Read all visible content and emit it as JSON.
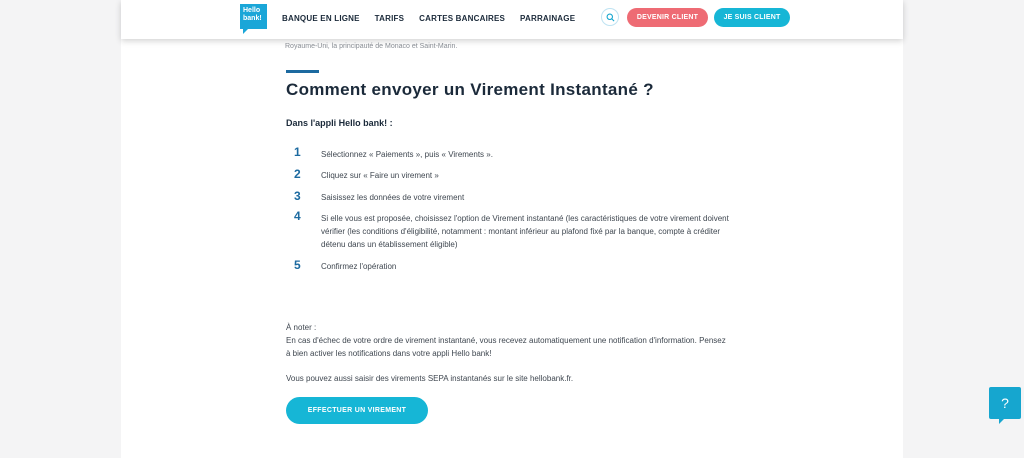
{
  "header": {
    "logo_text": "Hello bank!",
    "nav": [
      "BANQUE EN LIGNE",
      "TARIFS",
      "CARTES BANCAIRES",
      "PARRAINAGE"
    ],
    "search_icon": "search-icon",
    "btn_devenir": "DEVENIR CLIENT",
    "btn_suis": "JE SUIS CLIENT"
  },
  "content": {
    "clipped_text": "Royaume-Uni, la principauté de Monaco et Saint-Marin.",
    "heading": "Comment envoyer un Virement Instantané ?",
    "subheading": "Dans l'appli Hello bank! :",
    "steps": [
      {
        "num": "1",
        "text": "Sélectionnez « Paiements », puis « Virements »."
      },
      {
        "num": "2",
        "text": "Cliquez sur « Faire un virement »"
      },
      {
        "num": "3",
        "text": "Saisissez les données de votre virement"
      },
      {
        "num": "4",
        "text": "Si elle vous est proposée, choisissez l'option de Virement instantané (les caractéristiques de votre virement doivent vérifier (les conditions d'éligibilité, notamment : montant inférieur au plafond fixé par la banque, compte à créditer détenu dans un établissement éligible)"
      },
      {
        "num": "5",
        "text": "Confirmez l'opération"
      }
    ],
    "note_title": "À noter :",
    "note_text": "En cas d'échec de votre ordre de virement instantané, vous recevez automatiquement une notification d'information. Pensez à bien activer les notifications dans votre appli Hello bank!",
    "sepa_text": "Vous pouvez aussi saisir des virements SEPA instantanés sur le site hellobank.fr.",
    "cta": "EFFECTUER UN VIREMENT"
  },
  "help": {
    "label": "?"
  },
  "colors": {
    "primary": "#16b6d6",
    "accent": "#ee6b74",
    "dark": "#1b2a3a",
    "step": "#1c6aa0"
  }
}
